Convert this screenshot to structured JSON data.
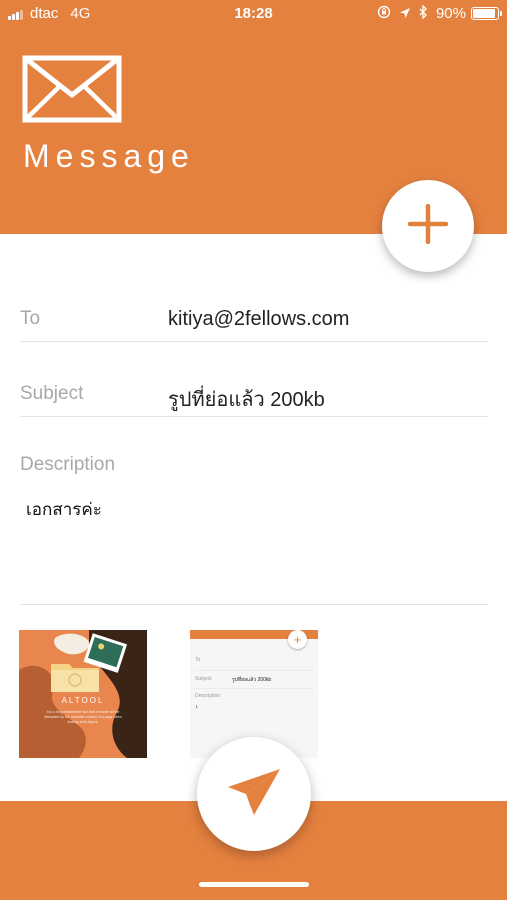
{
  "status_bar": {
    "carrier": "dtac",
    "network": "4G",
    "time": "18:28",
    "battery_percent": "90%",
    "battery_level": 0.9,
    "icons": [
      "signal-icon",
      "rotation-lock-icon",
      "location-icon",
      "bluetooth-icon",
      "battery-icon"
    ]
  },
  "header": {
    "title": "Message",
    "icon": "envelope-icon",
    "add_button_icon": "plus-icon"
  },
  "form": {
    "to_label": "To",
    "to_value": "kitiya@2fellows.com",
    "subject_label": "Subject",
    "subject_value": "รูปที่ย่อแล้ว 200kb",
    "description_label": "Description",
    "description_value": "เอกสารค่ะ"
  },
  "attachments": [
    {
      "brand": "ALTOOL",
      "text": "It is a long established fact that a reader will be distracted by the readable content of a page when looking at its layout."
    },
    {
      "to_label": "To",
      "subject_label": "Subject",
      "subject_value": "รูปที่ย่อแล้ว 200kb",
      "description_label": "Description",
      "description_value": "เ"
    }
  ],
  "footer": {
    "send_button_icon": "paper-plane-icon"
  },
  "colors": {
    "accent": "#e5813f",
    "background": "#ffffff",
    "label": "#a8a8a8",
    "divider": "#e3e3e3",
    "text": "#222222"
  }
}
